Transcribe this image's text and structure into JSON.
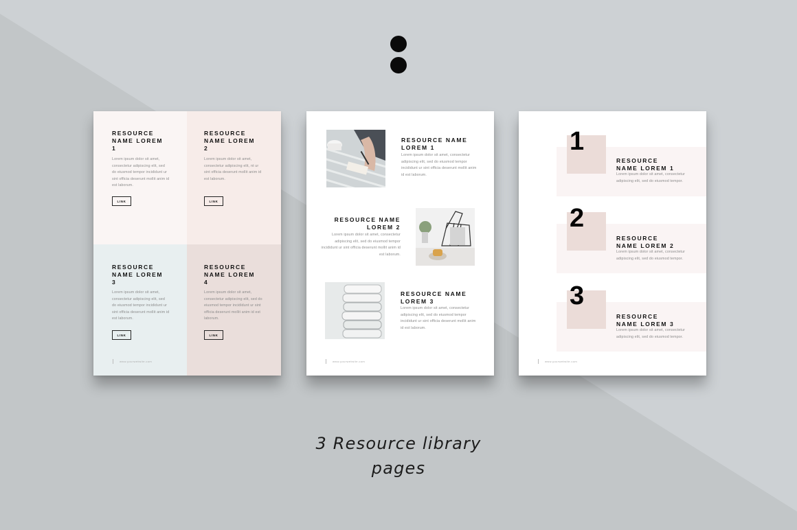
{
  "caption": {
    "line1": "3 Resource library",
    "line2": "pages"
  },
  "page1": {
    "quadrants": [
      {
        "title": "RESOURCE\nNAME LOREM\n1",
        "body": "Lorem ipsum dolor sit amet, consectetur adipiscing elit, sed do eiusmod tempor incididunt ur sint officia deserunt mollit anim id est laborum.",
        "link": "LINK",
        "color": "#faf5f4"
      },
      {
        "title": "RESOURCE\nNAME LOREM\n2",
        "body": "Lorem ipsum dolor sit amet, consectetur adipiscing elit, nt ur sint officia deserunt mollit anim id est laborum.",
        "link": "LINK",
        "color": "#f7ece9"
      },
      {
        "title": "RESOURCE\nNAME LOREM\n3",
        "body": "Lorem ipsum dolor sit amet, consectetur adipiscing elit, sed do eiusmod tempor incididunt ur sint officia deserunt mollit anim id est laborum.",
        "link": "LINK",
        "color": "#e8eff0"
      },
      {
        "title": "RESOURCE\nNAME LOREM\n4",
        "body": "Lorem ipsum dolor sit amet, consectetur adipiscing elit, sed do eiusmod tempor incididunt ur sint officia deserunt mollit anim id est laborum.",
        "link": "LINK",
        "color": "#eadedb"
      }
    ],
    "footer": "www.yourwebsite.com"
  },
  "page2": {
    "items": [
      {
        "title": "RESOURCE NAME\nLOREM 1",
        "body": "Lorem ipsum dolor sit amet, consectetur adipiscing elit, sed do eiusmod tempor incididunt ur sint officia deserunt mollit anim id est laborum.",
        "photo": "writing-notebook-photo"
      },
      {
        "title": "RESOURCE NAME\nLOREM 2",
        "body": "Lorem ipsum dolor sit amet, consectetur adipiscing elit, sed do eiusmod tempor incididunt ur sint officia deserunt mollit anim id est laborum.",
        "photo": "magazine-basket-photo"
      },
      {
        "title": "RESOURCE NAME\nLOREM 3",
        "body": "Lorem ipsum dolor sit amet, consectetur adipiscing elit, sed do eiusmod tempor incididunt ur sint officia deserunt mollit anim id est laborum.",
        "photo": "stacked-files-photo"
      }
    ],
    "footer": "www.yourwebsite.com"
  },
  "page3": {
    "items": [
      {
        "number": "1",
        "title": "RESOURCE\nNAME LOREM 1",
        "body": "Lorem ipsum dolor sit amet, consectetur adipiscing elit, sed do eiusmod tempor."
      },
      {
        "number": "2",
        "title": "RESOURCE\nNAME LOREM 2",
        "body": "Lorem ipsum dolor sit amet, consectetur adipiscing elit, sed do eiusmod tempor."
      },
      {
        "number": "3",
        "title": "RESOURCE\nNAME LOREM 3",
        "body": "Lorem ipsum dolor sit amet, consectetur adipiscing elit, sed do eiusmod tempor."
      }
    ],
    "footer": "www.yourwebsite.com"
  },
  "colors": {
    "background": "#cdd1d4",
    "background_dark": "#c0c4c6",
    "accent_blush": "#ebdcd8"
  }
}
